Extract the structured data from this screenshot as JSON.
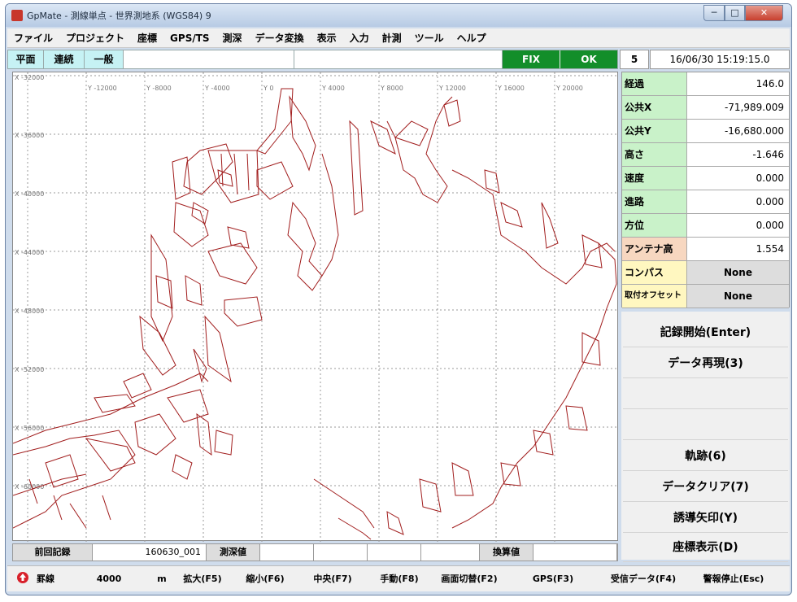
{
  "window": {
    "title": "GpMate - 測線単点 - 世界測地系 (WGS84)  9",
    "min": "─",
    "max": "□",
    "close": "✕"
  },
  "menu": [
    "ファイル",
    "プロジェクト",
    "座標",
    "GPS/TS",
    "測深",
    "データ変換",
    "表示",
    "入力",
    "計測",
    "ツール",
    "ヘルプ"
  ],
  "modes": {
    "m1": "平面",
    "m2": "連続",
    "m3": "一般",
    "fix": "FIX",
    "ok": "OK"
  },
  "status": {
    "satellites": "5",
    "datetime": "16/06/30 15:19:15.0"
  },
  "map": {
    "xlabels": [
      "Y -12000",
      "Y -8000",
      "Y -4000",
      "Y 0",
      "Y 4000",
      "Y 8000",
      "Y 12000",
      "Y 16000",
      "Y 20000"
    ],
    "ylabels": [
      "X -36000",
      "X -40000",
      "X -44000",
      "X -48000",
      "X -52000",
      "X -56000",
      "X -60000"
    ],
    "corner": "X -32000",
    "line_color": "#a11d1d"
  },
  "panel": [
    {
      "label": "経過",
      "value": "146.0",
      "color": "#c9f2c9"
    },
    {
      "label": "公共X",
      "value": "-71,989.009",
      "color": "#c9f2c9"
    },
    {
      "label": "公共Y",
      "value": "-16,680.000",
      "color": "#c9f2c9"
    },
    {
      "label": "高さ",
      "value": "-1.646",
      "color": "#c9f2c9"
    },
    {
      "label": "速度",
      "value": "0.000",
      "color": "#c9f2c9"
    },
    {
      "label": "進路",
      "value": "0.000",
      "color": "#c9f2c9"
    },
    {
      "label": "方位",
      "value": "0.000",
      "color": "#c9f2c9"
    },
    {
      "label": "アンテナ高",
      "value": "1.554",
      "color": "#f7d7c0"
    },
    {
      "label": "コンパス",
      "value": "None",
      "color": "#fff7c0"
    },
    {
      "label": "取付オフセット",
      "value": "None",
      "color": "#fff7c0"
    }
  ],
  "actions": {
    "a1": "記録開始(Enter)",
    "a2": "データ再現(3)",
    "a3": "軌跡(6)",
    "a4": "データクリア(7)",
    "a5": "誘導矢印(Y)",
    "a6": "座標表示(D)"
  },
  "bottom": {
    "prev_label": "前回記録",
    "prev_value": "160630_001",
    "depth_label": "測深値",
    "conv_label": "換算値"
  },
  "fkeys": {
    "grid_label": "罫線",
    "grid_value": "4000",
    "unit": "m",
    "f5": "拡大(F5)",
    "f6": "縮小(F6)",
    "f7": "中央(F7)",
    "f8": "手動(F8)",
    "f2": "画面切替(F2)",
    "f3": "GPS(F3)",
    "f4": "受信データ(F4)",
    "esc": "警報停止(Esc)"
  }
}
